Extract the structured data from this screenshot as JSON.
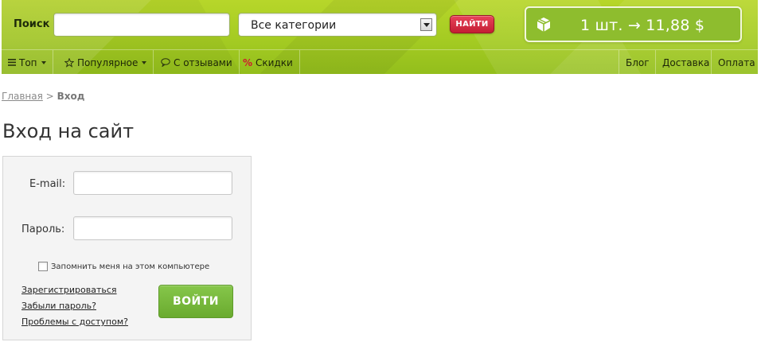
{
  "header": {
    "search_label": "Поиск",
    "search_value": "",
    "search_placeholder": "",
    "category_selected": "Все категории",
    "search_button": "НАЙТИ",
    "cart_summary": "1 шт. → 11,88 $"
  },
  "nav": {
    "left": [
      {
        "label": "Топ",
        "icon": "list-icon",
        "dropdown": true
      },
      {
        "label": "Популярное",
        "icon": "star-icon",
        "dropdown": true
      },
      {
        "label": "С отзывами",
        "icon": "speech-bubble-icon",
        "dropdown": false
      },
      {
        "label": "Скидки",
        "icon": "percent-icon",
        "dropdown": false
      }
    ],
    "right": [
      {
        "label": "Блог"
      },
      {
        "label": "Доставка"
      },
      {
        "label": "Оплата"
      }
    ],
    "percent_symbol": "%"
  },
  "breadcrumb": {
    "home": "Главная",
    "separator": ">",
    "current": "Вход"
  },
  "page_title": "Вход на сайт",
  "login": {
    "email_label": "E-mail:",
    "email_value": "",
    "password_label": "Пароль:",
    "password_value": "",
    "remember_label": "Запомнить меня на этом компьютере",
    "remember_checked": false,
    "links": [
      "Зарегистрироваться",
      "Забыли пароль?",
      "Проблемы с доступом?"
    ],
    "submit_label": "ВОЙТИ"
  },
  "colors": {
    "header_green": "#a4cb22",
    "search_button_red": "#d22a40",
    "cart_green": "#8ebd2e",
    "login_button_green": "#78b83c",
    "sale_percent_red": "#d0182e"
  }
}
